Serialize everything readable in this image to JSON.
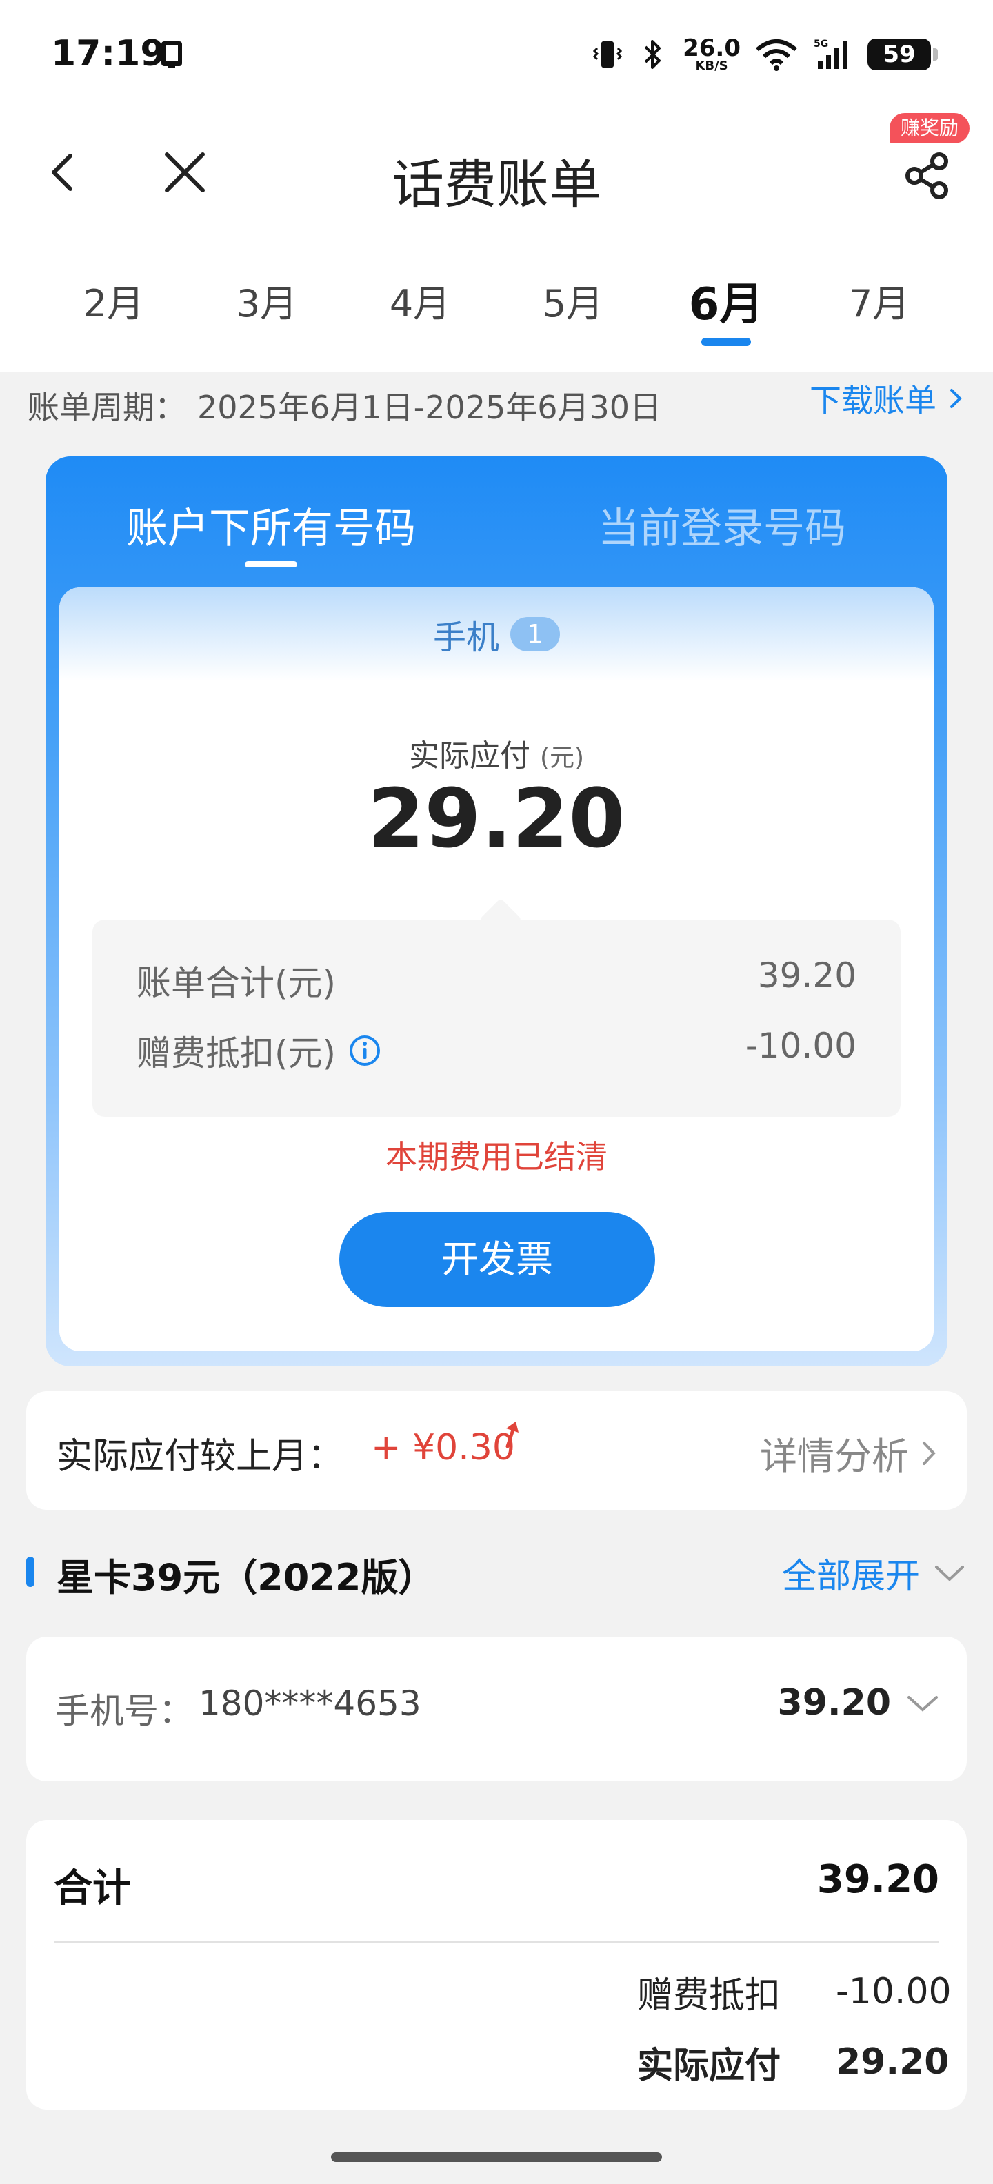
{
  "status_bar": {
    "time": "17:19",
    "net_speed_value": "26.0",
    "net_speed_unit": "KB/S",
    "battery": "59",
    "icons": [
      "phone-screen-icon",
      "vibrate-icon",
      "bluetooth-icon",
      "wifi-icon",
      "5g-signal-icon",
      "battery-icon"
    ]
  },
  "nav": {
    "title": "话费账单",
    "reward_badge": "赚奖励",
    "icons": [
      "back-icon",
      "close-icon",
      "share-icon"
    ]
  },
  "months": {
    "tabs": [
      "2月",
      "3月",
      "4月",
      "5月",
      "6月",
      "7月"
    ],
    "active_index": 4
  },
  "period": {
    "label": "账单周期：",
    "value": "2025年6月1日-2025年6月30日",
    "download": "下载账单"
  },
  "summary": {
    "tabs": [
      "账户下所有号码",
      "当前登录号码"
    ],
    "active_tab": 0,
    "phone_label": "手机",
    "phone_count": "1",
    "pay_label": "实际应付",
    "pay_unit": "(元)",
    "pay_amount": "29.20",
    "bill_total_label": "账单合计(元)",
    "bill_total_value": "39.20",
    "gift_deduct_label": "赠费抵扣(元)",
    "gift_deduct_value": "-10.00",
    "status_text": "本期费用已结清",
    "invoice_button": "开发票"
  },
  "compare": {
    "label": "实际应付较上月：",
    "value": "+ ¥0.30",
    "link": "详情分析"
  },
  "plan": {
    "title": "星卡39元（2022版）",
    "expand": "全部展开",
    "number_label": "手机号：",
    "number_value": "180****4653",
    "number_amount": "39.20"
  },
  "totals": {
    "total_label": "合计",
    "total_value": "39.20",
    "deduct_label": "赠费抵扣",
    "deduct_value": "-10.00",
    "pay_label": "实际应付",
    "pay_value": "29.20"
  },
  "colors": {
    "accent": "#1a86ee",
    "alert": "#e0443a",
    "badge": "#f4525a",
    "background": "#f2f2f2"
  }
}
